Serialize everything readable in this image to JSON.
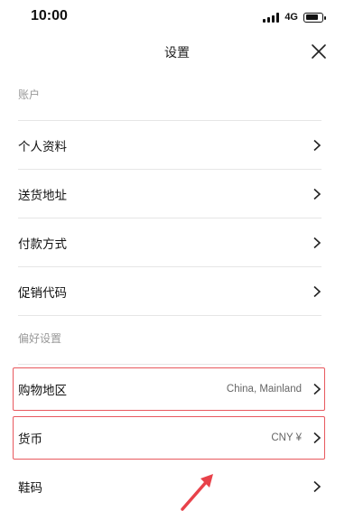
{
  "status_bar": {
    "time": "10:00",
    "network": "4G",
    "battery_level": 0.8
  },
  "header": {
    "title": "设置",
    "close_icon": "close-icon"
  },
  "sections": [
    {
      "header": "账户",
      "items": [
        {
          "label": "个人资料",
          "value": ""
        },
        {
          "label": "送货地址",
          "value": ""
        },
        {
          "label": "付款方式",
          "value": ""
        },
        {
          "label": "促销代码",
          "value": ""
        }
      ]
    },
    {
      "header": "偏好设置",
      "items": [
        {
          "label": "购物地区",
          "value": "China, Mainland",
          "highlighted": true
        },
        {
          "label": "货币",
          "value": "CNY ¥",
          "highlighted": true
        },
        {
          "label": "鞋码",
          "value": ""
        }
      ]
    }
  ],
  "colors": {
    "highlight_border": "#e8585e",
    "divider": "#e6e6e6",
    "annotation_arrow": "#e8424a"
  }
}
